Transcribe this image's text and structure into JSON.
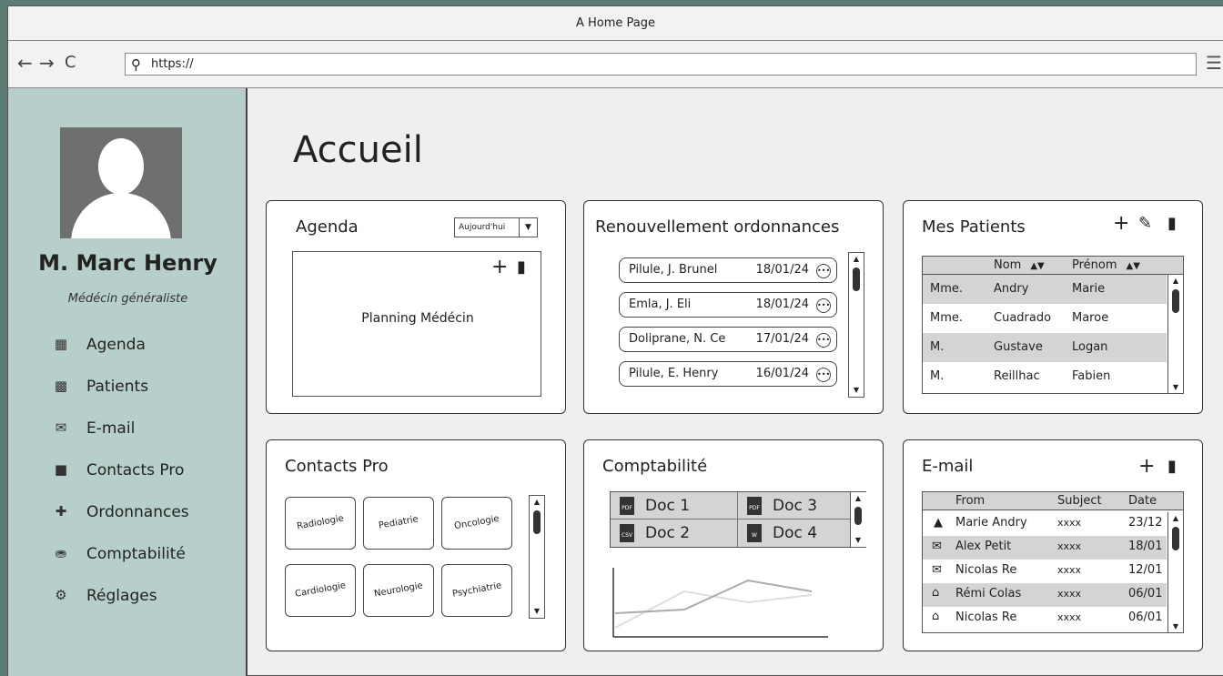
{
  "window": {
    "title": "A Home Page"
  },
  "browser": {
    "url": "https://",
    "back_icon": "back-arrow-icon",
    "forward_icon": "forward-arrow-icon",
    "reload_icon": "reload-icon",
    "search_icon": "search-icon",
    "menu_icon": "hamburger-menu-icon"
  },
  "sidebar": {
    "name": "M. Marc Henry",
    "role": "Médécin généraliste",
    "items": [
      {
        "label": "Agenda",
        "icon": "calendar-icon"
      },
      {
        "label": "Patients",
        "icon": "patients-icon"
      },
      {
        "label": "E-mail",
        "icon": "envelope-icon"
      },
      {
        "label": "Contacts Pro",
        "icon": "address-book-icon"
      },
      {
        "label": "Ordonnances",
        "icon": "prescription-icon"
      },
      {
        "label": "Comptabilité",
        "icon": "coins-icon"
      },
      {
        "label": "Réglages",
        "icon": "gear-icon"
      }
    ]
  },
  "main": {
    "title": "Accueil",
    "agenda": {
      "title": "Agenda",
      "period": "Aujourd'hui",
      "planning_label": "Planning Médécin"
    },
    "renewals": {
      "title": "Renouvellement ordonnances",
      "items": [
        {
          "label": "Pilule, J. Brunel",
          "date": "18/01/24"
        },
        {
          "label": "Emla, J. Eli",
          "date": "18/01/24"
        },
        {
          "label": "Doliprane, N. Ce",
          "date": "17/01/24"
        },
        {
          "label": "Pilule, E. Henry",
          "date": "16/01/24"
        }
      ]
    },
    "patients": {
      "title": "Mes Patients",
      "columns": [
        "",
        "Nom",
        "Prénom"
      ],
      "rows": [
        [
          "Mme.",
          "Andry",
          "Marie"
        ],
        [
          "Mme.",
          "Cuadrado",
          "Maroe"
        ],
        [
          "M.",
          "Gustave",
          "Logan"
        ],
        [
          "M.",
          "Reillhac",
          "Fabien"
        ]
      ]
    },
    "contacts": {
      "title": "Contacts Pro",
      "chips": [
        "Radiologie",
        "Pediatrie",
        "Oncologie",
        "Cardiologie",
        "Neurologie",
        "Psychiatrie"
      ]
    },
    "accounting": {
      "title": "Comptabilité",
      "docs": [
        {
          "label": "Doc 1",
          "type": "PDF"
        },
        {
          "label": "Doc 3",
          "type": "PDF"
        },
        {
          "label": "Doc 2",
          "type": "CSV"
        },
        {
          "label": "Doc 4",
          "type": "W"
        }
      ]
    },
    "email": {
      "title": "E-mail",
      "columns": [
        "From",
        "Subject",
        "Date"
      ],
      "rows": [
        {
          "icon": "pin-icon",
          "from": "Marie Andry",
          "subject": "xxxx",
          "date": "23/12"
        },
        {
          "icon": "new-mail-icon",
          "from": "Alex Petit",
          "subject": "xxxx",
          "date": "18/01"
        },
        {
          "icon": "new-mail-icon",
          "from": "Nicolas Re",
          "subject": "xxxx",
          "date": "12/01"
        },
        {
          "icon": "open-envelope-icon",
          "from": "Rémi Colas",
          "subject": "xxxx",
          "date": "06/01"
        },
        {
          "icon": "open-envelope-icon",
          "from": "Nicolas Re",
          "subject": "xxxx",
          "date": "06/01"
        }
      ]
    }
  }
}
